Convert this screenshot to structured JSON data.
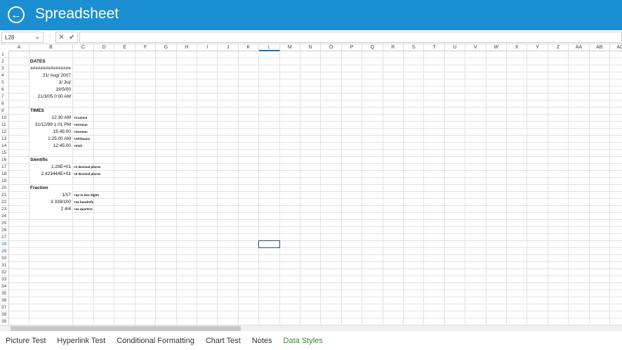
{
  "header": {
    "title": "Spreadsheet",
    "back_icon": "back-arrow-icon"
  },
  "formula_bar": {
    "name_box": "L28",
    "cancel_icon": "✕",
    "confirm_icon": "✔",
    "formula": ""
  },
  "columns": [
    "A",
    "B",
    "C",
    "D",
    "E",
    "F",
    "G",
    "H",
    "I",
    "J",
    "K",
    "L",
    "M",
    "N",
    "O",
    "P",
    "Q",
    "R",
    "S",
    "T",
    "U",
    "V",
    "W",
    "X",
    "Y",
    "Z",
    "AA",
    "AB",
    "AC"
  ],
  "row_count": 40,
  "selected": {
    "col": "L",
    "row": 28
  },
  "cells": [
    {
      "row": 2,
      "col": "B",
      "text": "DATES",
      "bold": true
    },
    {
      "row": 3,
      "col": "B",
      "text": "################",
      "bold": false
    },
    {
      "row": 4,
      "col": "B",
      "text": "21/ Aug/ 2007",
      "align": "right"
    },
    {
      "row": 5,
      "col": "B",
      "text": "3/ Jul/",
      "align": "right"
    },
    {
      "row": 6,
      "col": "B",
      "text": "19/5/00",
      "align": "right"
    },
    {
      "row": 7,
      "col": "B",
      "text": "21/3/05 0:00 AM",
      "align": "right"
    },
    {
      "row": 9,
      "col": "B",
      "text": "TIMES",
      "bold": true
    },
    {
      "row": 10,
      "col": "B",
      "text": "12:30 AM",
      "align": "right"
    },
    {
      "row": 10,
      "col": "C",
      "text": "<Custom",
      "note": true
    },
    {
      "row": 11,
      "col": "B",
      "text": "31/12/99 1:01 PM",
      "align": "right"
    },
    {
      "row": 11,
      "col": "C",
      "text": "<German",
      "note": true
    },
    {
      "row": 12,
      "col": "B",
      "text": "15:45:00",
      "align": "right"
    },
    {
      "row": 12,
      "col": "C",
      "text": "<German",
      "note": true
    },
    {
      "row": 13,
      "col": "B",
      "text": "1:25:00 AM",
      "align": "right"
    },
    {
      "row": 13,
      "col": "C",
      "text": "<Afrikaans",
      "note": true
    },
    {
      "row": 14,
      "col": "B",
      "text": "12:45:00",
      "align": "right"
    },
    {
      "row": 14,
      "col": "C",
      "text": "<Irish",
      "note": true
    },
    {
      "row": 16,
      "col": "B",
      "text": "Sientific",
      "bold": true
    },
    {
      "row": 17,
      "col": "B",
      "text": "1.29E+01",
      "align": "right"
    },
    {
      "row": 17,
      "col": "C",
      "text": "<2 decimal places",
      "note": true
    },
    {
      "row": 18,
      "col": "B",
      "text": "2.423444E+01",
      "align": "right"
    },
    {
      "row": 18,
      "col": "C",
      "text": "<6 decimal places",
      "note": true
    },
    {
      "row": 20,
      "col": "B",
      "text": "Fraction",
      "bold": true
    },
    {
      "row": 21,
      "col": "B",
      "text": "1/17",
      "align": "right"
    },
    {
      "row": 21,
      "col": "C",
      "text": "<up to two digits",
      "note": true
    },
    {
      "row": 22,
      "col": "B",
      "text": "3 339/100",
      "align": "right"
    },
    {
      "row": 22,
      "col": "C",
      "text": "<as hundrefs",
      "note": true
    },
    {
      "row": 23,
      "col": "B",
      "text": "2 4/4",
      "align": "right"
    },
    {
      "row": 23,
      "col": "C",
      "text": "<as quarters",
      "note": true
    }
  ],
  "sheet_tabs": [
    {
      "label": "Picture Test",
      "active": false
    },
    {
      "label": "Hyperlink Test",
      "active": false
    },
    {
      "label": "Conditional Formatting",
      "active": false
    },
    {
      "label": "Chart Test",
      "active": false
    },
    {
      "label": "Notes",
      "active": false
    },
    {
      "label": "Data Styles",
      "active": true
    }
  ],
  "colors": {
    "header": "#1b8ed1",
    "active_tab": "#3a8a3a"
  }
}
